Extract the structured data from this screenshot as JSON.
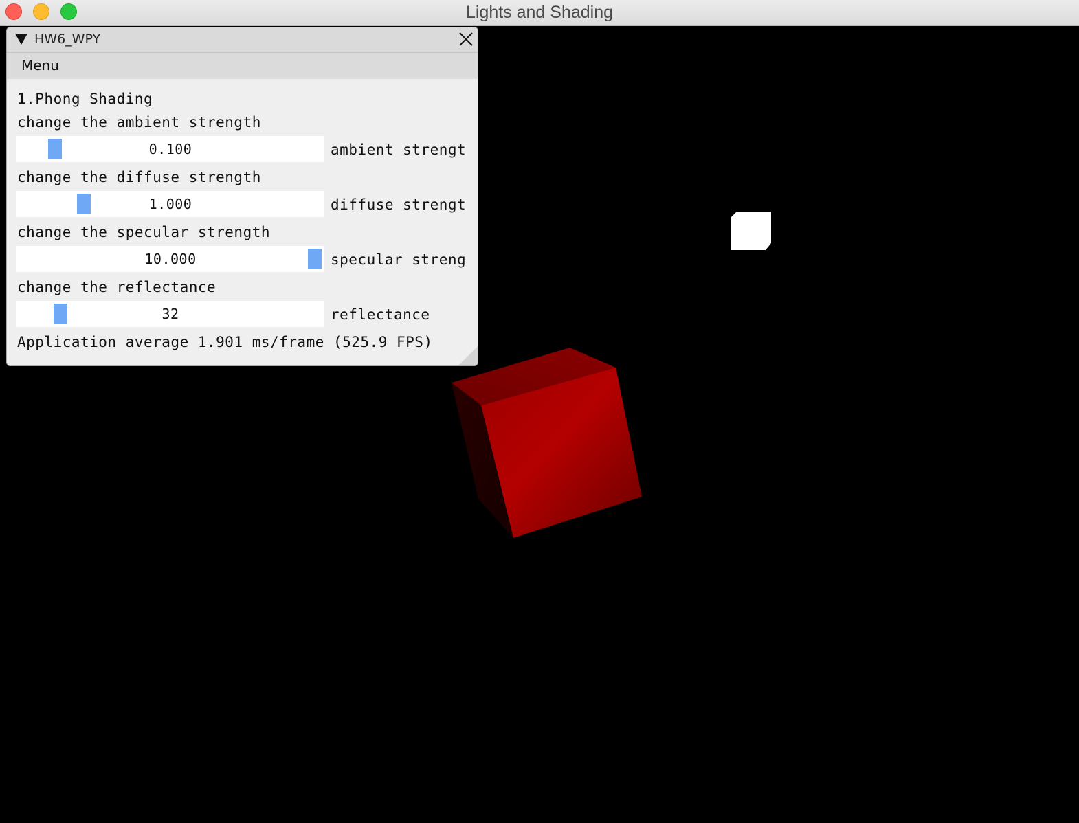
{
  "window": {
    "title": "Lights and Shading"
  },
  "panel": {
    "title": "HW6_WPY",
    "menu": "Menu",
    "section_title": "1.Phong Shading",
    "controls": [
      {
        "prompt": "change the ambient strength",
        "value": "0.100",
        "label": "ambient strengt"
      },
      {
        "prompt": "change the diffuse strength",
        "value": "1.000",
        "label": "diffuse strengt"
      },
      {
        "prompt": "change the specular strength",
        "value": "10.000",
        "label": "specular streng"
      },
      {
        "prompt": "change the reflectance",
        "value": "32",
        "label": "reflectance"
      }
    ],
    "fps_text": "Application average 1.901 ms/frame (525.9 FPS)"
  },
  "colors": {
    "slider_handle": "#6fa8f5",
    "cube_front": "#b00000",
    "light": "#ffffff",
    "background": "#000000"
  }
}
